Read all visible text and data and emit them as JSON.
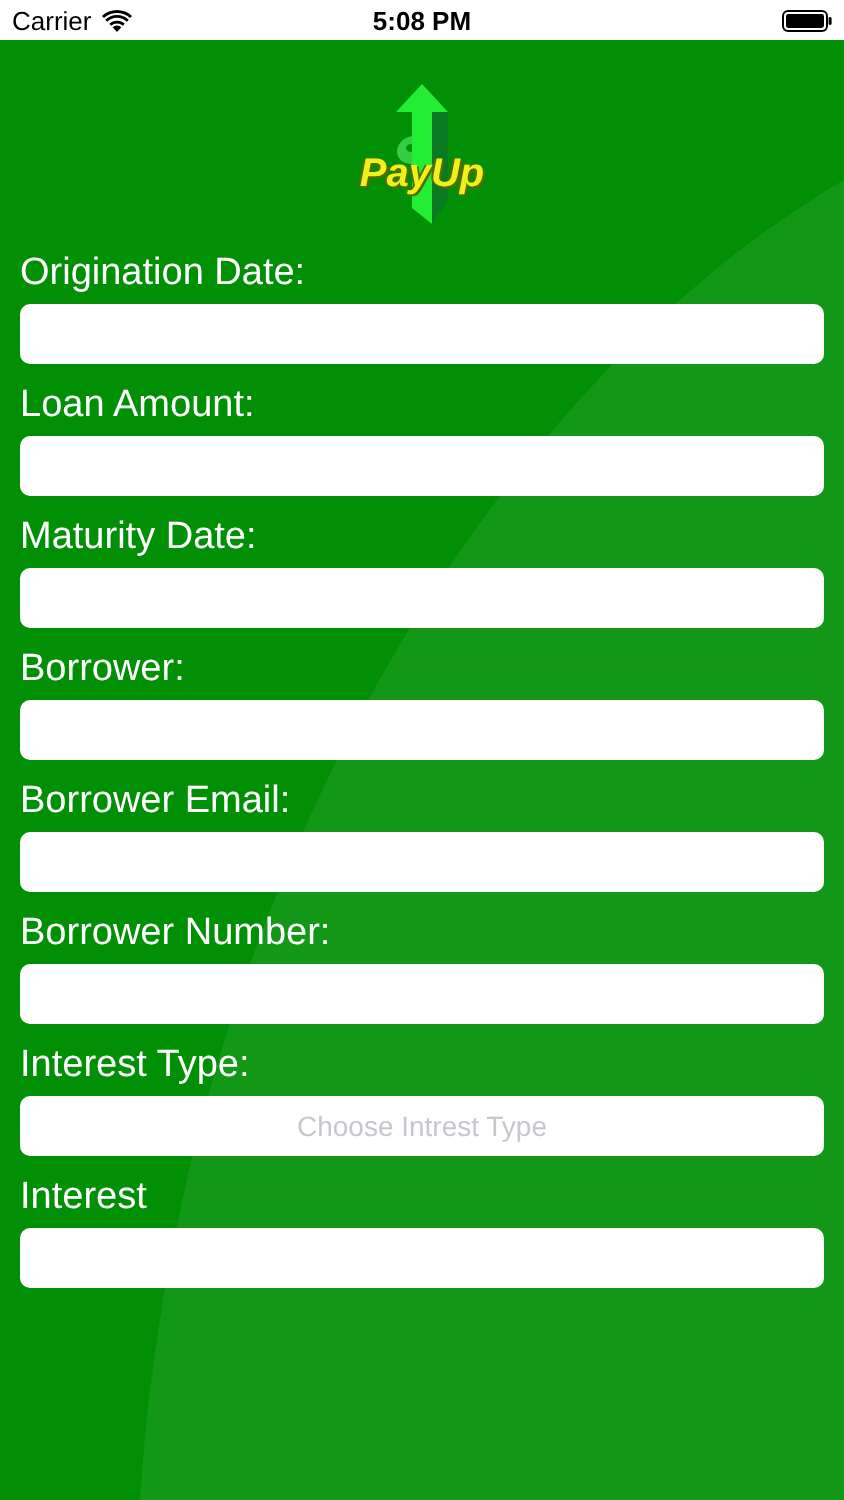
{
  "status_bar": {
    "carrier": "Carrier",
    "time": "5:08 PM"
  },
  "logo": {
    "text": "PayUp"
  },
  "fields": [
    {
      "label": "Origination Date:",
      "kind": "text"
    },
    {
      "label": "Loan Amount:",
      "kind": "text"
    },
    {
      "label": "Maturity Date:",
      "kind": "text"
    },
    {
      "label": "Borrower:",
      "kind": "text"
    },
    {
      "label": "Borrower Email:",
      "kind": "text"
    },
    {
      "label": "Borrower Number:",
      "kind": "text"
    },
    {
      "label": "Interest Type:",
      "kind": "picker",
      "placeholder": "Choose Intrest Type"
    },
    {
      "label": "Interest",
      "kind": "text"
    }
  ]
}
